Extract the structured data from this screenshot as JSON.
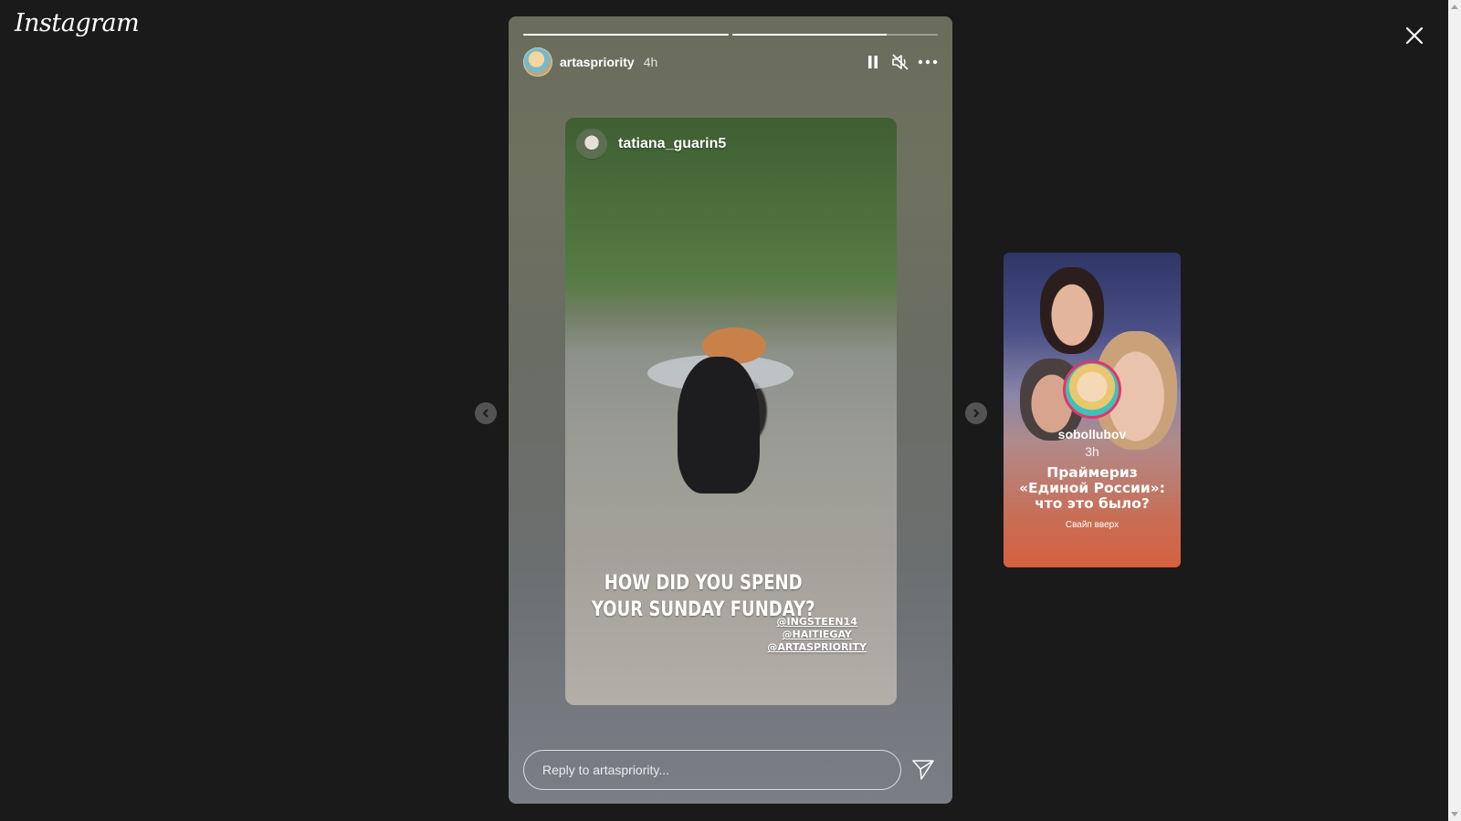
{
  "app": {
    "logo_text": "Instagram"
  },
  "story": {
    "progress": [
      1.0,
      0.75
    ],
    "username": "artaspriority",
    "time_ago": "4h",
    "media": {
      "shared_username": "tatiana_guarin5",
      "caption": "HOW DID YOU SPEND YOUR SUNDAY FUNDAY?",
      "tags": [
        "@INGSTEEN14",
        "@HAITIEGAY",
        "@ARTASPRIORITY"
      ]
    },
    "reply_placeholder": "Reply to artaspriority..."
  },
  "next_story": {
    "username": "sobollubov",
    "time_ago": "3h",
    "headline": "Праймериз «Единой России»: что это было?",
    "cta": "Свайп вверх"
  },
  "colors": {
    "background": "#1a1a1a",
    "next_avatar_ring": "#e6336b"
  },
  "icons": [
    "close-icon",
    "pause-icon",
    "mute-icon",
    "more-icon",
    "send-icon",
    "chevron-left-icon",
    "chevron-right-icon"
  ]
}
